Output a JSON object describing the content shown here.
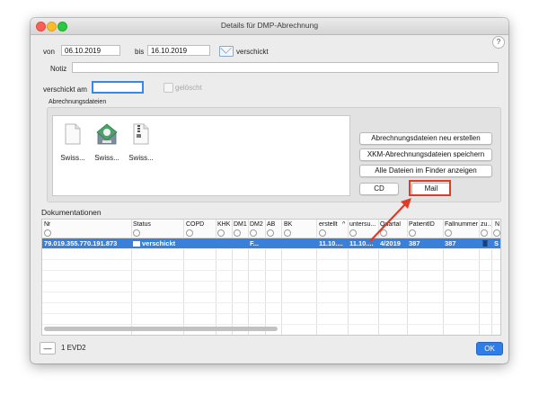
{
  "window": {
    "title": "Details für DMP-Abrechnung"
  },
  "help_glyph": "?",
  "form": {
    "von_label": "von",
    "von_value": "06.10.2019",
    "bis_label": "bis",
    "bis_value": "16.10.2019",
    "verschickt_label": "verschickt",
    "notiz_label": "Notiz",
    "notiz_value": "",
    "verschickt_am_label": "verschickt am",
    "verschickt_am_value": "",
    "geloescht_label": "gelöscht"
  },
  "files_group": {
    "title": "Abrechnungsdateien",
    "files": [
      {
        "name": "Swiss...",
        "icon": "generic-document-icon"
      },
      {
        "name": "Swiss...",
        "icon": "xkm-archive-icon"
      },
      {
        "name": "Swiss...",
        "icon": "zip-document-icon"
      }
    ],
    "buttons": {
      "neu_erstellen": "Abrechnungsdateien neu erstellen",
      "xkm_speichern": "XKM-Abrechnungsdateien speichern",
      "finder": "Alle Dateien im Finder anzeigen",
      "cd": "CD",
      "mail": "Mail"
    }
  },
  "doc_section": {
    "title": "Dokumentationen",
    "columns": [
      "Nr",
      "Status",
      "COPD",
      "KHK",
      "DM1",
      "DM2",
      "AB",
      "BK",
      "erstellt",
      "^",
      "untersu...",
      "Quartal",
      "PatientID",
      "Fallnummer",
      "zu...",
      "N"
    ],
    "rows": [
      {
        "nr": "79.019.355.770.191.873",
        "status": "verschickt",
        "dm2": "F...",
        "erstellt": "11.10....",
        "untersu": "11.10....",
        "quartal": "4/2019",
        "patientid": "387",
        "fallnummer": "387",
        "last": "S"
      }
    ]
  },
  "footer": {
    "minus": "—",
    "count_label": "1 EVD2",
    "ok_label": "OK"
  },
  "colors": {
    "accent": "#3880d8",
    "highlight": "#e03b27"
  }
}
